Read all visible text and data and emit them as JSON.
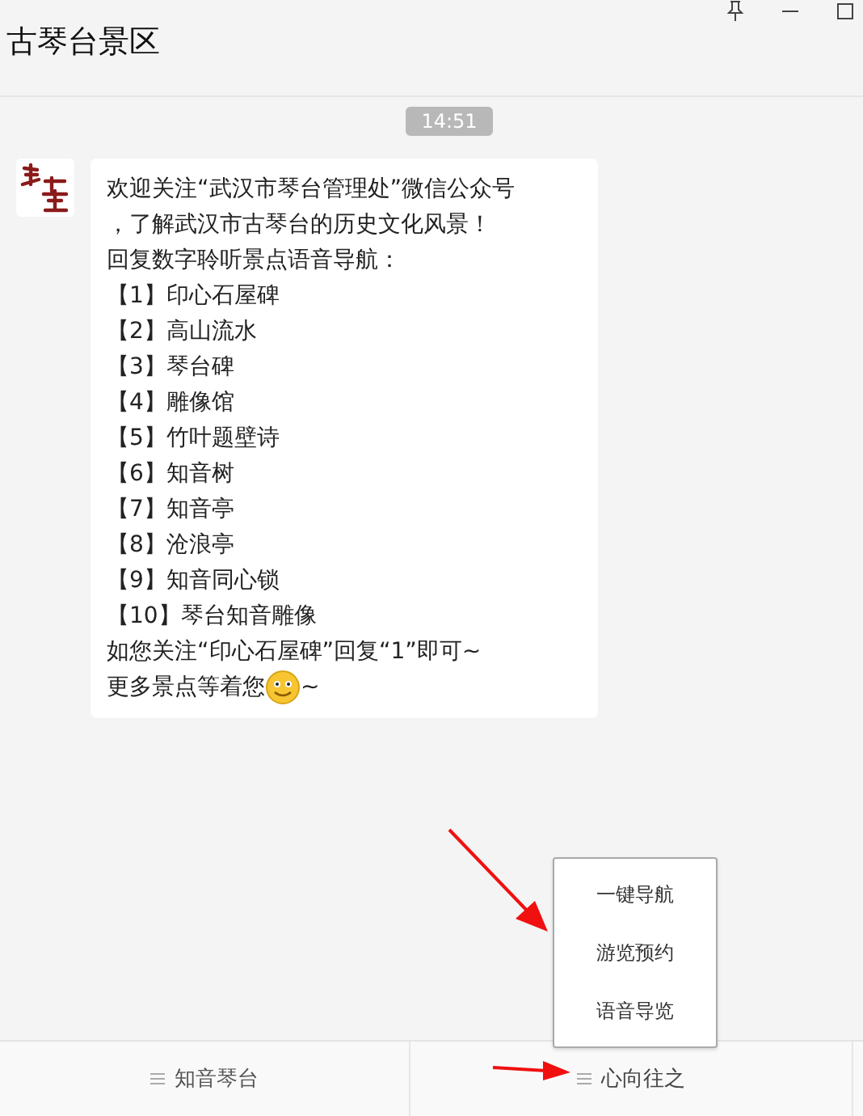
{
  "window": {
    "title": "古琴台景区"
  },
  "timestamp": "14:51",
  "message": {
    "lines": [
      "欢迎关注“武汉市琴台管理处”微信公众号",
      "，了解武汉市古琴台的历史文化风景！",
      "回复数字聆听景点语音导航：",
      "【1】印心石屋碑",
      "【2】高山流水",
      "【3】琴台碑",
      "【4】雕像馆",
      "【5】竹叶题壁诗",
      "【6】知音树",
      "【7】知音亭",
      "【8】沧浪亭",
      "【9】知音同心锁",
      "【10】琴台知音雕像",
      "如您关注“印心石屋碑”回复“1”即可~"
    ],
    "last_line": {
      "before_emoji": "更多景点等着您",
      "after_emoji": "~"
    }
  },
  "popup_menu": {
    "items": [
      "一键导航",
      "游览预约",
      "语音导览"
    ]
  },
  "bottom_menu": [
    {
      "label": "知音琴台",
      "expanded": false
    },
    {
      "label": "心向往之",
      "expanded": true
    }
  ]
}
